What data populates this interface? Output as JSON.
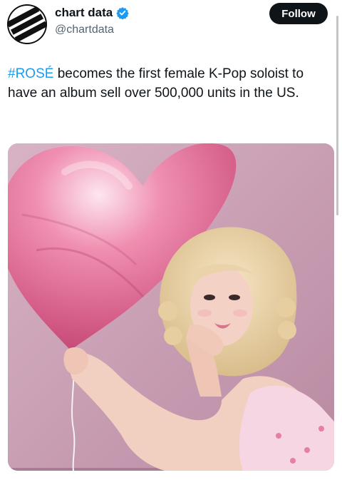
{
  "author": {
    "name": "chart data",
    "handle": "@chartdata",
    "verified": true,
    "avatar_icon": "chart-data-logo-icon"
  },
  "follow_button": {
    "label": "Follow"
  },
  "tweet": {
    "hashtag": "#ROSÉ",
    "text": " becomes the first female K-Pop soloist to have an album sell over 500,000 units in the US."
  },
  "media": {
    "icon": "photo",
    "accent_colors": {
      "background": "#c69fb3",
      "balloon": "#e0638f"
    }
  },
  "colors": {
    "link": "#1d9bf0",
    "verified": "#1d9bf0",
    "text": "#0f1419",
    "secondary": "#536471",
    "button": "#0f1419"
  }
}
